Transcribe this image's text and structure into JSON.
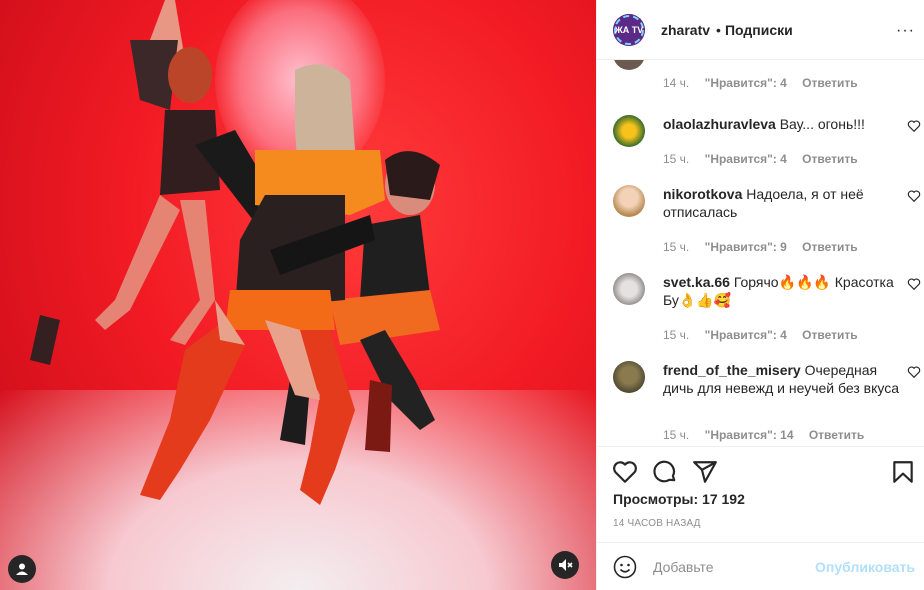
{
  "header": {
    "username": "zharatv",
    "separator": "•",
    "follow_label": "Подписки",
    "more": "···",
    "logo_text": "ЖА TV"
  },
  "comments": [
    {
      "username": "",
      "text": "",
      "time": "14 ч.",
      "likes": "\"Нравится\": 4",
      "reply": "Ответить"
    },
    {
      "username": "olaolazhuravleva",
      "text": "Вау... огонь!!!",
      "time": "15 ч.",
      "likes": "\"Нравится\": 4",
      "reply": "Ответить"
    },
    {
      "username": "nikorotkova",
      "text": "Надоела, я от неё отписалась",
      "time": "15 ч.",
      "likes": "\"Нравится\": 9",
      "reply": "Ответить"
    },
    {
      "username": "svet.ka.66",
      "text": "Горячо🔥🔥🔥 Красотка Бу👌👍🥰",
      "time": "15 ч.",
      "likes": "\"Нравится\": 4",
      "reply": "Ответить"
    },
    {
      "username": "frend_of_the_misery",
      "text": "Очередная дичь для невежд и неучей без вкуса",
      "time": "15 ч.",
      "likes": "\"Нравится\": 14",
      "reply": "Ответить"
    }
  ],
  "actions": {
    "views_label": "Просмотры: 17 192",
    "timestamp": "14 ЧАСОВ НАЗАД"
  },
  "add_comment": {
    "placeholder": "Добавьте",
    "post_label": "Опубликовать"
  },
  "colors": {
    "accent": "#0095f6",
    "post_disabled": "#b2dffc",
    "muted": "#8e8e8e",
    "text": "#262626",
    "backdrop_red": "#f21b24"
  },
  "icons": {
    "like": "heart-icon",
    "comment": "comment-bubble-icon",
    "share": "paper-plane-icon",
    "save": "bookmark-icon",
    "emoji": "smiley-icon",
    "mute": "speaker-muted-icon",
    "tagged": "user-icon"
  }
}
